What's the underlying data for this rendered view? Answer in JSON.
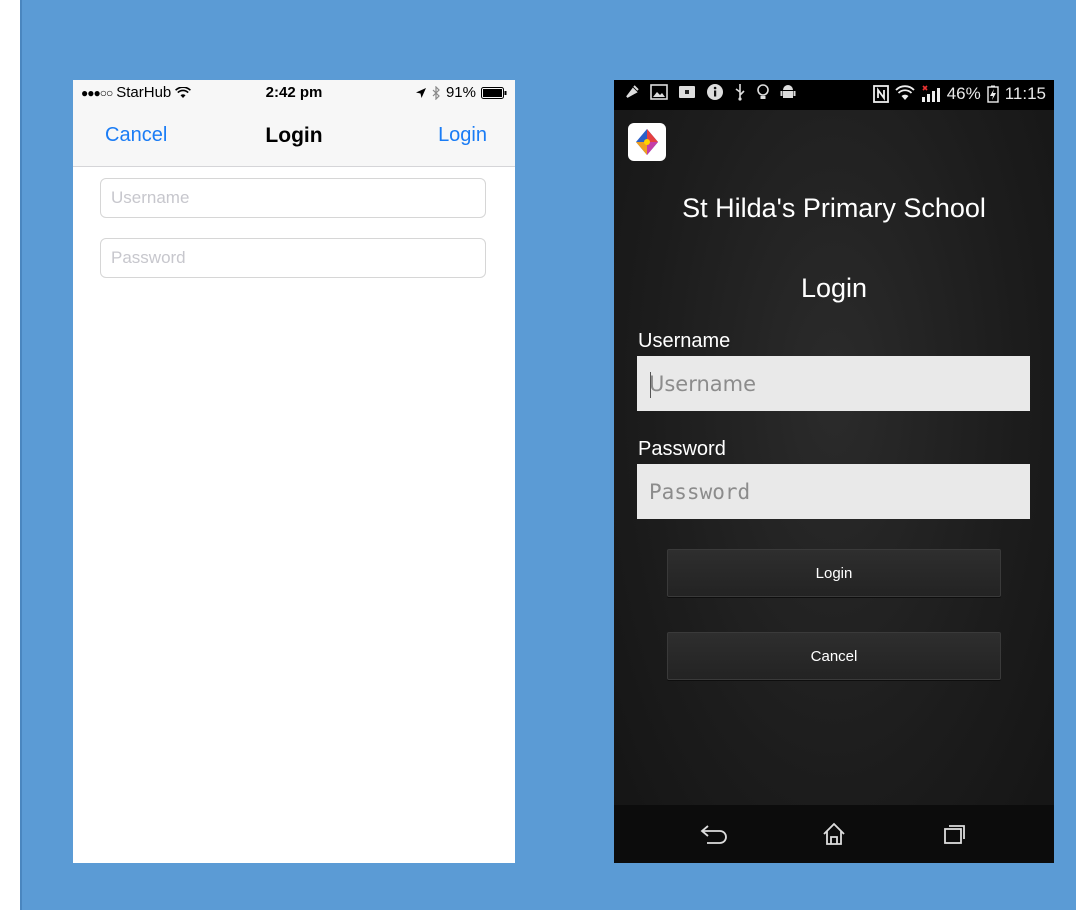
{
  "ios": {
    "status": {
      "carrier": "StarHub",
      "time": "2:42 pm",
      "battery": "91%"
    },
    "nav": {
      "cancel_label": "Cancel",
      "title": "Login",
      "login_label": "Login"
    },
    "username_placeholder": "Username",
    "password_placeholder": "Password",
    "accent_color": "#1a7cf5"
  },
  "android": {
    "status": {
      "battery": "46%",
      "time": "11:15"
    },
    "school_name": "St Hilda's Primary School",
    "title": "Login",
    "username_label": "Username",
    "username_placeholder": "Username",
    "password_label": "Password",
    "password_placeholder": "Password",
    "login_button": "Login",
    "cancel_button": "Cancel",
    "nav_icons": [
      "back-icon",
      "home-icon",
      "recent-apps-icon"
    ]
  }
}
